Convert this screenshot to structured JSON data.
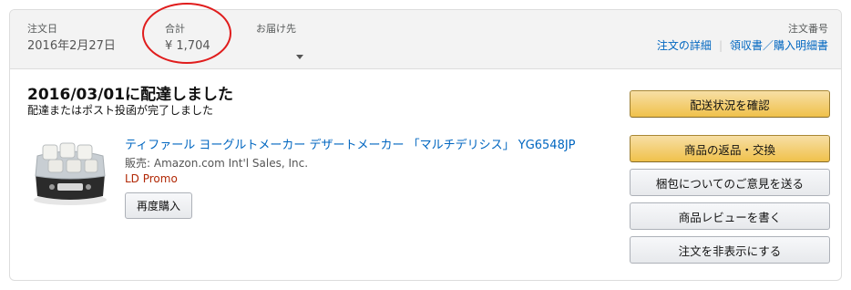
{
  "header": {
    "date_label": "注文日",
    "date_value": "2016年2月27日",
    "total_label": "合計",
    "total_value": "¥ 1,704",
    "ship_label": "お届け先",
    "order_label": "注文番号",
    "details_link": "注文の詳細",
    "receipt_link": "領収書／購入明細書"
  },
  "status": {
    "title": "2016/03/01に配達しました",
    "subtitle": "配達またはポスト投函が完了しました"
  },
  "product": {
    "title": "ティファール ヨーグルトメーカー デザートメーカー 「マルチデリシス」 YG6548JP",
    "seller": "販売: Amazon.com Int'l Sales, Inc.",
    "promo": "LD Promo",
    "rebuy_label": "再度購入"
  },
  "actions": {
    "track": "配送状況を確認",
    "return": "商品の返品・交換",
    "feedback": "梱包についてのご意見を送る",
    "review": "商品レビューを書く",
    "hide": "注文を非表示にする"
  },
  "colors": {
    "link": "#0066c0",
    "promo": "#b12704",
    "annotation_circle": "#e01d1d",
    "primary_button": "#f0c14b"
  }
}
